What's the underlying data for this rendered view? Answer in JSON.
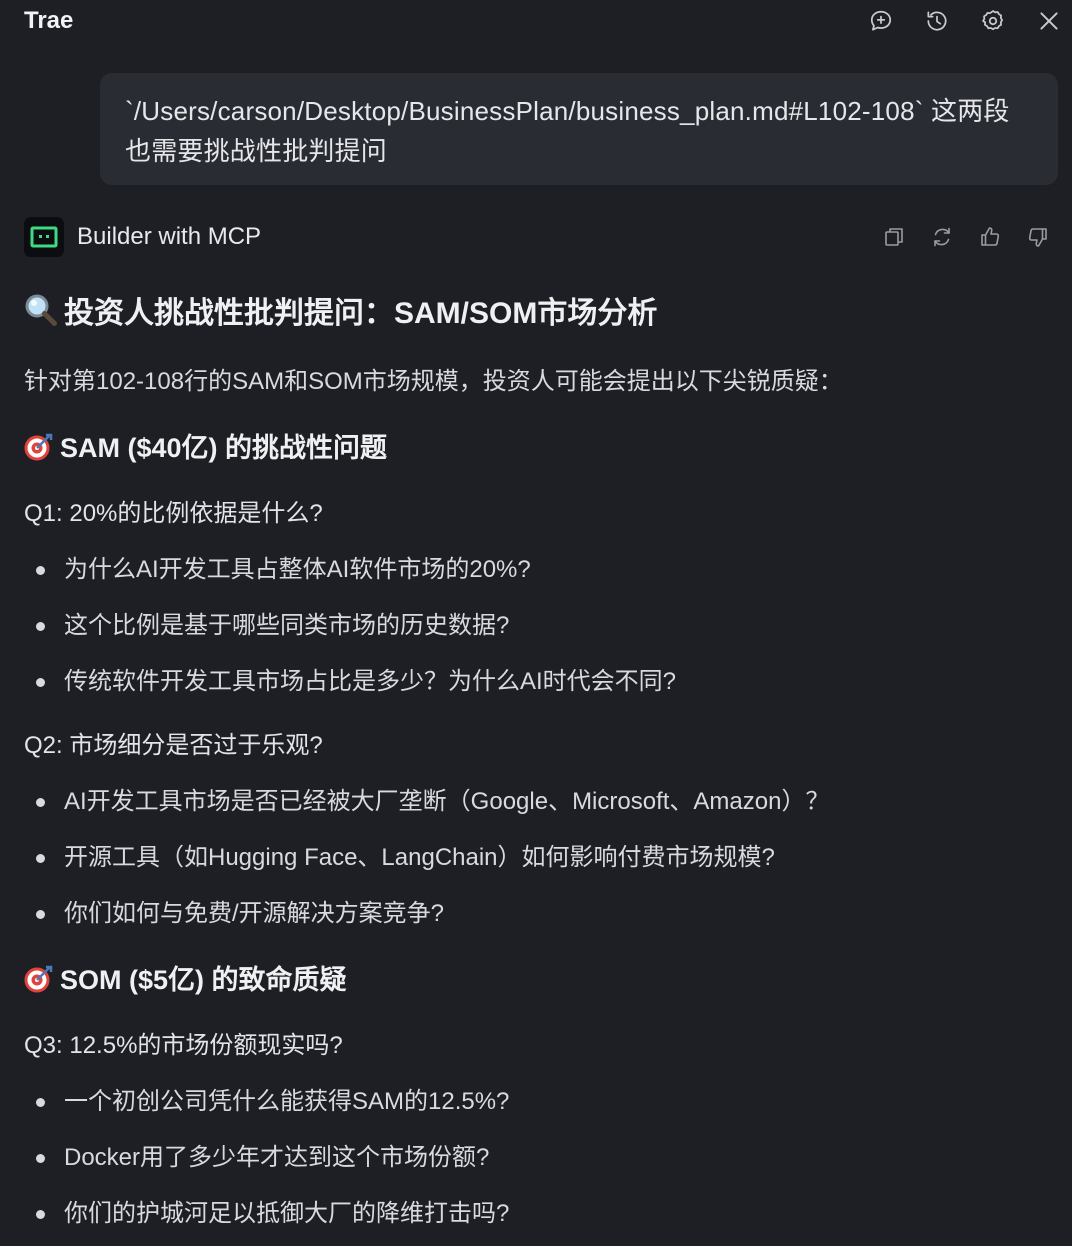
{
  "window": {
    "title": "Trae",
    "icons": [
      "new-chat-icon",
      "history-icon",
      "settings-icon",
      "close-icon"
    ]
  },
  "user_message": {
    "text": "`/Users/carson/Desktop/BusinessPlan/business_plan.md#L102-108` 这两段也需要挑战性批判提问"
  },
  "agent": {
    "name": "Builder with MCP",
    "actions": [
      "copy-icon",
      "regenerate-icon",
      "thumbs-up-icon",
      "thumbs-down-icon"
    ]
  },
  "response": {
    "heading": "投资人挑战性批判提问：SAM/SOM市场分析",
    "heading_icon": "magnifier-icon",
    "intro": "针对第102-108行的SAM和SOM市场规模，投资人可能会提出以下尖锐质疑：",
    "sections": [
      {
        "title": "SAM ($40亿) 的挑战性问题",
        "icon": "target-icon",
        "questions": [
          {
            "q": "Q1: 20%的比例依据是什么?",
            "bullets": [
              "为什么AI开发工具占整体AI软件市场的20%?",
              "这个比例是基于哪些同类市场的历史数据?",
              "传统软件开发工具市场占比是多少？为什么AI时代会不同?"
            ]
          },
          {
            "q": "Q2: 市场细分是否过于乐观?",
            "bullets": [
              "AI开发工具市场是否已经被大厂垄断（Google、Microsoft、Amazon）？",
              "开源工具（如Hugging Face、LangChain）如何影响付费市场规模?",
              "你们如何与免费/开源解决方案竞争?"
            ]
          }
        ]
      },
      {
        "title": "SOM ($5亿) 的致命质疑",
        "icon": "target-icon",
        "questions": [
          {
            "q": "Q3: 12.5%的市场份额现实吗?",
            "bullets": [
              "一个初创公司凭什么能获得SAM的12.5%?",
              "Docker用了多少年才达到这个市场份额?",
              "你们的护城河足以抵御大厂的降维打击吗?"
            ]
          }
        ]
      }
    ]
  },
  "colors": {
    "background": "#1e1f25",
    "user_bubble": "#2a2c33",
    "avatar_accent": "#3ddc84",
    "target_red": "#e0443b"
  }
}
